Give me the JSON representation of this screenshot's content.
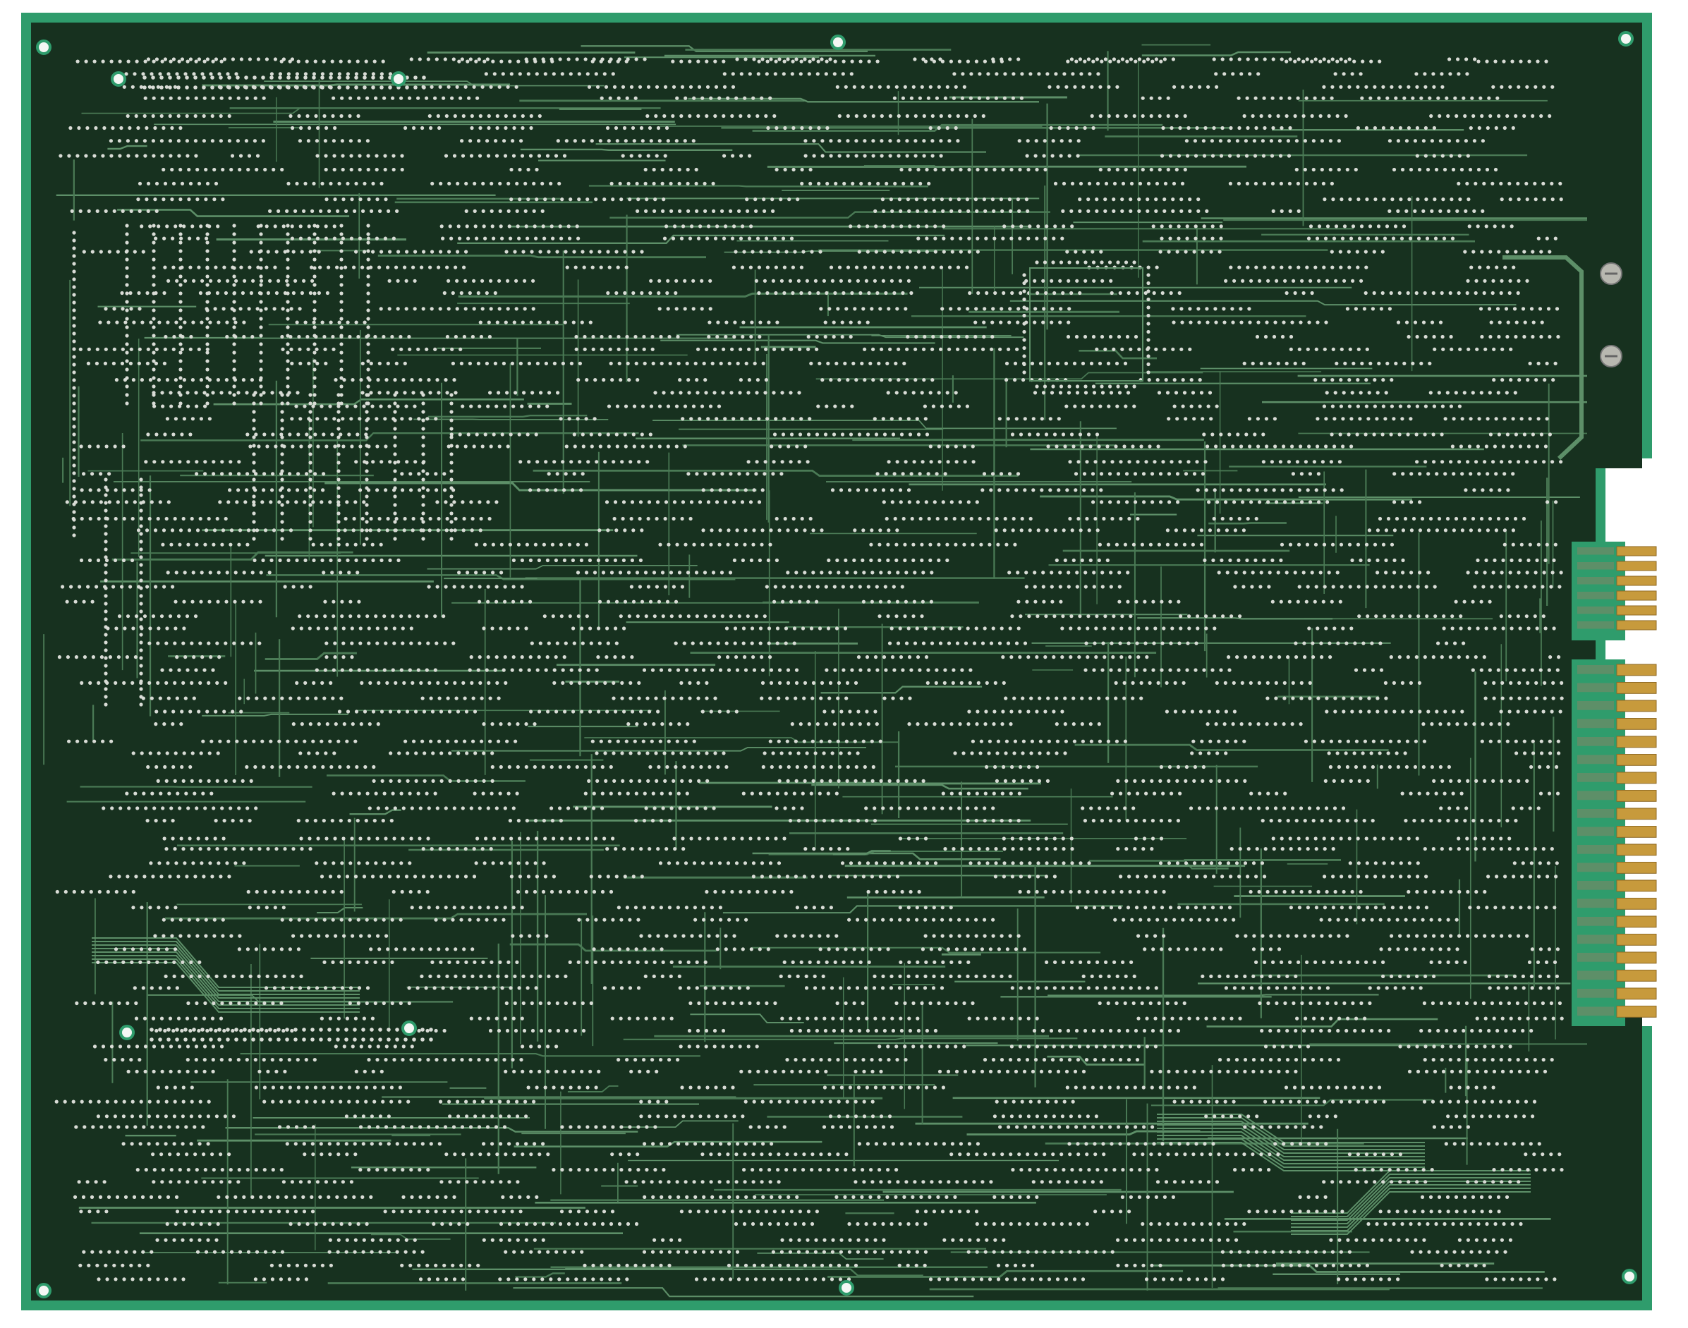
{
  "image": {
    "subject": "pcb-solder-side",
    "colors": {
      "background": "#ffffff",
      "board_edge": "#2f9c6c",
      "board_dark": "#17311f",
      "trace": "#4a7a55",
      "trace_light": "#5d8f68",
      "pad": "#d9dcd6",
      "gold_contact": "#c79a3c",
      "gold_contact_dark": "#8f6a24",
      "screw": "#b8b8b0"
    },
    "connector": {
      "top_block_pins": 6,
      "bottom_block_pins": 20
    }
  }
}
